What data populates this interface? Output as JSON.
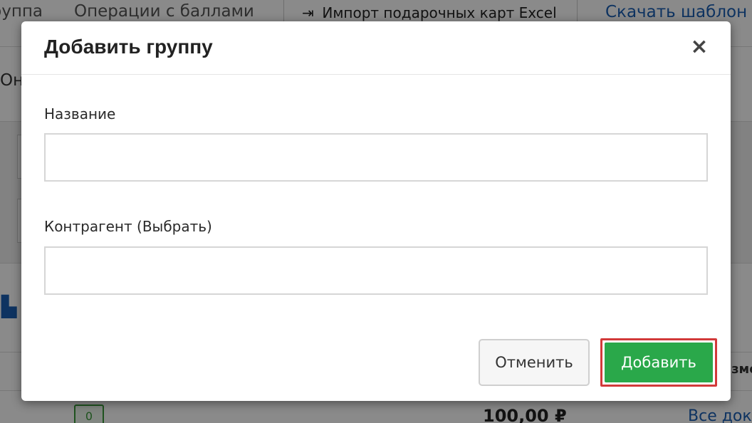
{
  "background": {
    "tabs": {
      "tab_partial_1": "Группа",
      "tab_points": "Операции с баллами",
      "import_label": "Импорт подарочных карт Excel",
      "download_link": "Скачать шаблон"
    },
    "side_text": "Оноз",
    "column_header_partial": "Измен",
    "row_badge": "0",
    "row_price": "100,00 ₽",
    "row_link": "Все документы"
  },
  "modal": {
    "title": "Добавить группу",
    "close_icon": "×",
    "fields": [
      {
        "label": "Название",
        "value": "",
        "placeholder": ""
      },
      {
        "label": "Контрагент (Выбрать)",
        "value": "",
        "placeholder": ""
      }
    ],
    "buttons": {
      "cancel_label": "Отменить",
      "add_label": "Добавить"
    }
  },
  "colors": {
    "primary_button": "#2aa84a",
    "highlight_outline": "#d23a3a",
    "link": "#1a5fb4"
  }
}
